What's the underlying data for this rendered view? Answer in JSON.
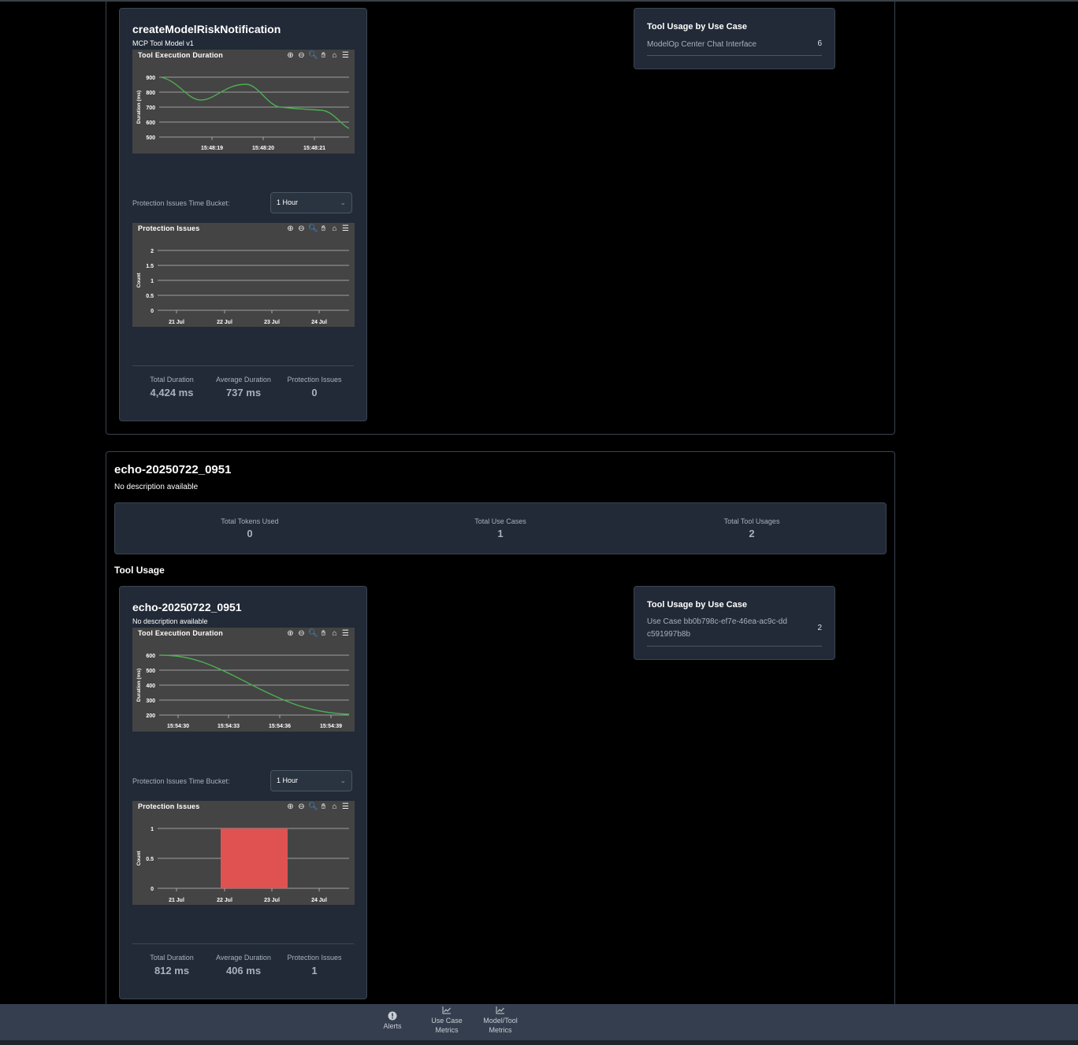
{
  "top_tool": {
    "title": "createModelRiskNotification",
    "subtitle": "MCP Tool Model v1",
    "duration_chart": {
      "title": "Tool Execution Duration",
      "ylabel": "Duration (ms)",
      "yticks": [
        "900",
        "800",
        "700",
        "600",
        "500"
      ],
      "xticks": [
        "15:48:19",
        "15:48:20",
        "15:48:21"
      ]
    },
    "bucket_label": "Protection Issues Time Bucket:",
    "bucket_value": "1 Hour",
    "issues_chart": {
      "title": "Protection Issues",
      "ylabel": "Count",
      "yticks": [
        "2",
        "1.5",
        "1",
        "0.5",
        "0"
      ],
      "xticks": [
        "21 Jul",
        "22 Jul",
        "23 Jul",
        "24 Jul"
      ]
    },
    "stats": [
      {
        "label": "Total Duration",
        "value": "4,424 ms"
      },
      {
        "label": "Average Duration",
        "value": "737 ms"
      },
      {
        "label": "Protection Issues",
        "value": "0"
      }
    ],
    "use_case_panel": {
      "title": "Tool Usage by Use Case",
      "rows": [
        {
          "name": "ModelOp Center Chat Interface",
          "count": "6"
        }
      ]
    }
  },
  "echo_section": {
    "title": "echo-20250722_0951",
    "description": "No description available",
    "summary": [
      {
        "label": "Total Tokens Used",
        "value": "0"
      },
      {
        "label": "Total Use Cases",
        "value": "1"
      },
      {
        "label": "Total Tool Usages",
        "value": "2"
      }
    ],
    "tool_usage_heading": "Tool Usage",
    "tool": {
      "title": "echo-20250722_0951",
      "subtitle": "No description available",
      "duration_chart": {
        "title": "Tool Execution Duration",
        "ylabel": "Duration (ms)",
        "yticks": [
          "600",
          "500",
          "400",
          "300",
          "200"
        ],
        "xticks": [
          "15:54:30",
          "15:54:33",
          "15:54:36",
          "15:54:39"
        ]
      },
      "bucket_label": "Protection Issues Time Bucket:",
      "bucket_value": "1 Hour",
      "issues_chart": {
        "title": "Protection Issues",
        "ylabel": "Count",
        "yticks": [
          "1",
          "0.5",
          "0"
        ],
        "xticks": [
          "21 Jul",
          "22 Jul",
          "23 Jul",
          "24 Jul"
        ]
      },
      "stats": [
        {
          "label": "Total Duration",
          "value": "812 ms"
        },
        {
          "label": "Average Duration",
          "value": "406 ms"
        },
        {
          "label": "Protection Issues",
          "value": "1"
        }
      ]
    },
    "use_case_panel": {
      "title": "Tool Usage by Use Case",
      "rows": [
        {
          "name": "Use Case bb0b798c-ef7e-46ea-ac9c-ddc591997b8b",
          "count": "2"
        }
      ]
    }
  },
  "bottom_nav": [
    {
      "label": "Alerts",
      "icon": "alert-icon"
    },
    {
      "label": "Use Case Metrics",
      "icon": "line-chart-icon"
    },
    {
      "label": "Model/Tool Metrics",
      "icon": "line-chart-icon"
    }
  ],
  "colors": {
    "line": "#4caf50",
    "bar": "#e05252",
    "card": "#212a36",
    "chart_bg": "#444444"
  }
}
